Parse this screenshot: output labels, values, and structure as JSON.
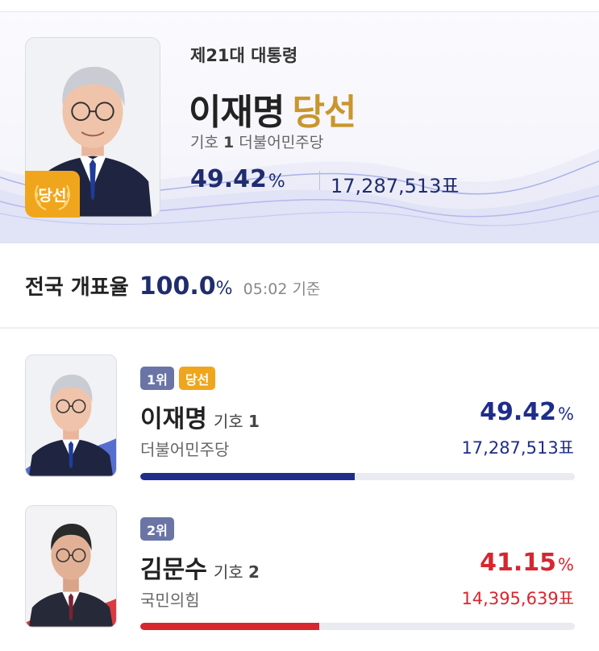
{
  "hero": {
    "election": "제21대 대통령",
    "name": "이재명",
    "status": "당선",
    "badge": "당선",
    "number_prefix": "기호",
    "number": "1",
    "party": "더불어민주당",
    "percent": "49.42",
    "percent_unit": "%",
    "votes": "17,287,513표"
  },
  "count": {
    "label": "전국 개표율",
    "value": "100.0",
    "unit": "%",
    "time": "05:02 기준",
    "progress": 1.0
  },
  "candidates": [
    {
      "rank": "1위",
      "status": "당선",
      "name": "이재명",
      "number_prefix": "기호",
      "number": "1",
      "party": "더불어민주당",
      "percent": "49.42",
      "percent_unit": "%",
      "votes": "17,287,513표",
      "share": 0.4942,
      "color": "#1f2d8a"
    },
    {
      "rank": "2위",
      "name": "김문수",
      "number_prefix": "기호",
      "number": "2",
      "party": "국민의힘",
      "percent": "41.15",
      "percent_unit": "%",
      "votes": "14,395,639표",
      "share": 0.4115,
      "color": "#d8262f"
    }
  ],
  "colors": {
    "accent_navy": "#1f2d6d",
    "gold": "#c9962d",
    "badge_orange": "#f0a61c",
    "rank_badge": "#6a75a6",
    "red": "#d8262f"
  }
}
